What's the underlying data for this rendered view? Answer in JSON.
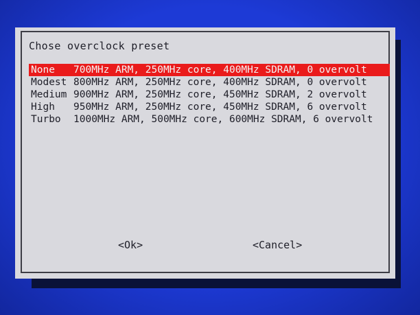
{
  "dialog": {
    "title": "Chose overclock preset",
    "presets": [
      {
        "name": "None",
        "description": "700MHz ARM, 250MHz core, 400MHz SDRAM, 0 overvolt",
        "selected": true
      },
      {
        "name": "Modest",
        "description": "800MHz ARM, 250MHz core, 400MHz SDRAM, 0 overvolt",
        "selected": false
      },
      {
        "name": "Medium",
        "description": "900MHz ARM, 250MHz core, 450MHz SDRAM, 2 overvolt",
        "selected": false
      },
      {
        "name": "High",
        "description": "950MHz ARM, 250MHz core, 450MHz SDRAM, 6 overvolt",
        "selected": false
      },
      {
        "name": "Turbo",
        "description": "1000MHz ARM, 500MHz core, 600MHz SDRAM, 6 overvolt",
        "selected": false
      }
    ],
    "ok_label": "<Ok>",
    "cancel_label": "<Cancel>"
  },
  "colors": {
    "background": "#1d3ad6",
    "dialog": "#d9d9de",
    "selection": "#ea1b1b",
    "text": "#1e1e28"
  }
}
